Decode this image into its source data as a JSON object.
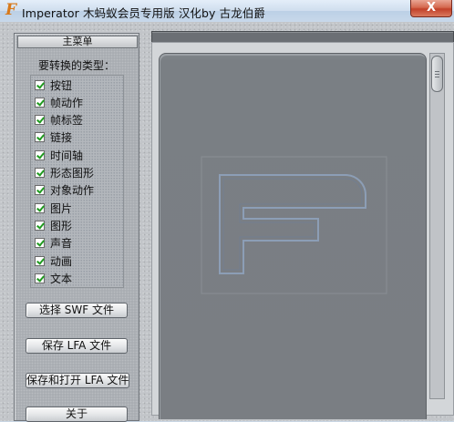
{
  "window": {
    "app_icon_glyph": "F",
    "title": "Imperator  木蚂蚁会员专用版  汉化by 古龙伯爵",
    "close_glyph": "X"
  },
  "sidebar": {
    "header": "主菜单",
    "section_label": "要转换的类型：",
    "types": [
      {
        "label": "按钮",
        "checked": true
      },
      {
        "label": "帧动作",
        "checked": true
      },
      {
        "label": "帧标签",
        "checked": true
      },
      {
        "label": "链接",
        "checked": true
      },
      {
        "label": "时间轴",
        "checked": true
      },
      {
        "label": "形态图形",
        "checked": true
      },
      {
        "label": "对象动作",
        "checked": true
      },
      {
        "label": "图片",
        "checked": true
      },
      {
        "label": "图形",
        "checked": true
      },
      {
        "label": "声音",
        "checked": true
      },
      {
        "label": "动画",
        "checked": true
      },
      {
        "label": "文本",
        "checked": true
      }
    ],
    "buttons": {
      "select_swf": "选择 SWF 文件",
      "save_lfa": "保存 LFA 文件",
      "save_open_lfa": "保存和打开 LFA 文件",
      "about": "关于"
    }
  },
  "colors": {
    "check": "#1f9a1f",
    "canvas": "#7a7f84",
    "watermark_stroke": "#8fa3be",
    "close_button": "#c2412a"
  },
  "icons": {
    "app": "flash-f-icon",
    "close": "close-icon",
    "checkbox": "checkmark-icon",
    "watermark": "flash-f-logo"
  }
}
